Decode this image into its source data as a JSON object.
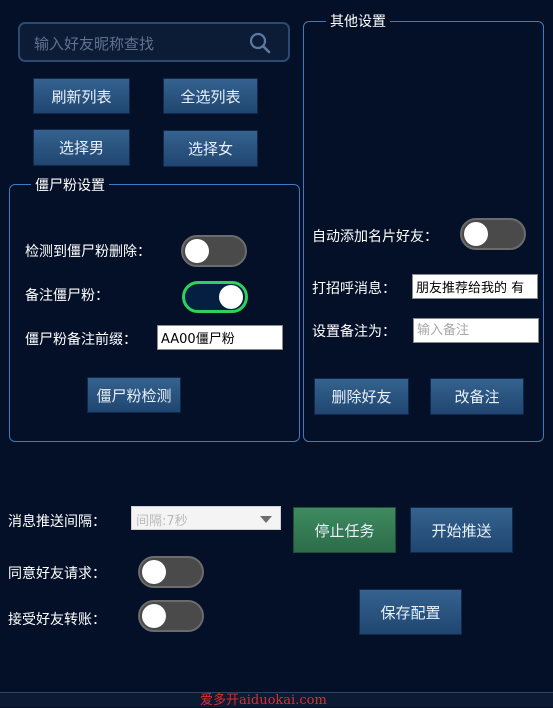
{
  "search": {
    "placeholder": "输入好友昵称查找"
  },
  "list_buttons": {
    "refresh": "刷新列表",
    "select_all": "全选列表",
    "select_male": "选择男",
    "select_female": "选择女"
  },
  "zombie": {
    "legend": "僵尸粉设置",
    "delete_label": "检测到僵尸粉删除：",
    "delete_on": false,
    "remark_label": "备注僵尸粉：",
    "remark_on": true,
    "prefix_label": "僵尸粉备注前缀：",
    "prefix_value": "AA00僵尸粉",
    "check_button": "僵尸粉检测"
  },
  "other": {
    "legend": "其他设置",
    "auto_add_label": "自动添加名片好友：",
    "auto_add_on": false,
    "greeting_label": "打招呼消息：",
    "greeting_value": "朋友推荐给我的 有",
    "remark_set_label": "设置备注为：",
    "remark_placeholder": "输入备注",
    "delete_friend": "删除好友",
    "change_remark": "改备注"
  },
  "push": {
    "interval_label": "消息推送间隔：",
    "interval_value": "间隔:7秒",
    "stop_task": "停止任务",
    "start_push": "开始推送",
    "accept_request_label": "同意好友请求：",
    "accept_request_on": false,
    "accept_transfer_label": "接受好友转账：",
    "accept_transfer_on": false,
    "save_config": "保存配置"
  },
  "watermark": "爱多开aiduokai.com",
  "colors": {
    "background": "#041028",
    "button": "#2a5580",
    "button_active": "#3a8a5f",
    "group_border": "#3a7cc4",
    "toggle_on_border": "#2fd05c"
  }
}
